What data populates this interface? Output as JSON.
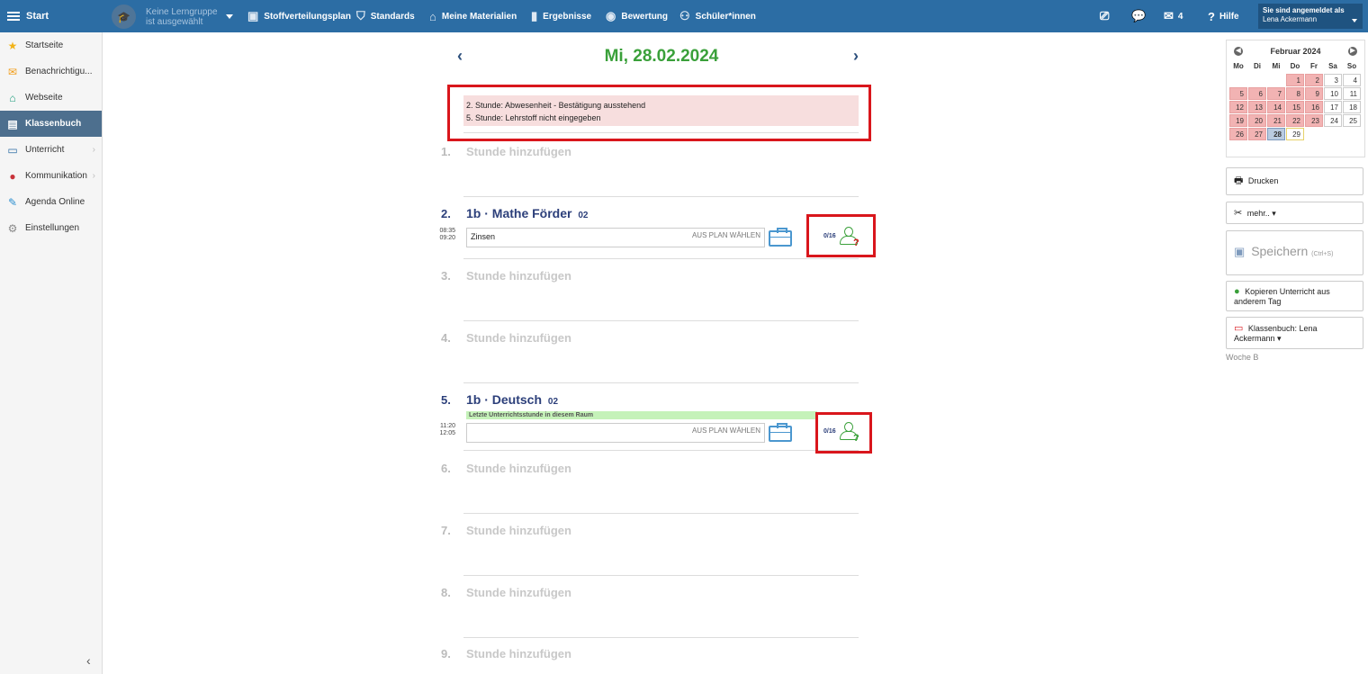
{
  "topbar": {
    "start_label": "Start",
    "group_line1": "Keine Lerngruppe",
    "group_line2": "ist ausgewählt",
    "nav": [
      {
        "label": "Stoffverteilungsplan",
        "icon": "briefcase-icon"
      },
      {
        "label": "Standards",
        "icon": "shield-icon"
      },
      {
        "label": "Meine Materialien",
        "icon": "library-icon"
      },
      {
        "label": "Ergebnisse",
        "icon": "bar-chart-icon"
      },
      {
        "label": "Bewertung",
        "icon": "rating-icon"
      },
      {
        "label": "Schüler*innen",
        "icon": "students-icon"
      }
    ],
    "message_count": "4",
    "help_label": "Hilfe",
    "user_label": "Sie sind angemeldet als",
    "user_name": "Lena Ackermann"
  },
  "sidebar": {
    "items": [
      {
        "label": "Startseite",
        "icon": "star-icon"
      },
      {
        "label": "Benachrichtigu...",
        "icon": "envelope-icon"
      },
      {
        "label": "Webseite",
        "icon": "home-icon"
      },
      {
        "label": "Klassenbuch",
        "icon": "book-icon",
        "active": true
      },
      {
        "label": "Unterricht",
        "icon": "classroom-icon"
      },
      {
        "label": "Kommunikation",
        "icon": "chat-icon"
      },
      {
        "label": "Agenda Online",
        "icon": "pen-icon"
      },
      {
        "label": "Einstellungen",
        "icon": "gear-icon"
      }
    ]
  },
  "main": {
    "date_title": "Mi, 28.02.2024",
    "warnings": [
      "2. Stunde: Abwesenheit - Bestätigung ausstehend",
      "5. Stunde: Lehrstoff nicht eingegeben"
    ],
    "add_label": "Stunde hinzufügen",
    "slots": {
      "s1": "1.",
      "s3": "3.",
      "s4": "4.",
      "s6": "6.",
      "s7": "7.",
      "s8": "8.",
      "s9": "9."
    },
    "lesson2": {
      "num": "2.",
      "title": "1b · Mathe Förder",
      "room": "02",
      "time_start": "08:35",
      "time_end": "09:20",
      "topic": "Zinsen",
      "plan_label": "AUS PLAN WÄHLEN",
      "attendance": "0/16",
      "status_color": "#d9161c"
    },
    "lesson5": {
      "num": "5.",
      "title": "1b · Deutsch",
      "room": "02",
      "time_start": "11:20",
      "time_end": "12:05",
      "notice": "Letzte Unterrichtsstunde in diesem Raum",
      "topic": "",
      "plan_label": "AUS PLAN WÄHLEN",
      "attendance": "0/16",
      "status_color": "#3aa03a"
    }
  },
  "calendar": {
    "month_label": "Februar 2024",
    "weekdays": [
      "Mo",
      "Di",
      "Mi",
      "Do",
      "Fr",
      "Sa",
      "So"
    ]
  },
  "right": {
    "print_label": "Drucken",
    "more_label": "mehr.. ▾",
    "save_label": "Speichern",
    "save_shortcut": "(Ctrl+S)",
    "copy_label": "Kopieren Unterricht aus anderem Tag",
    "classbook_label": "Klassenbuch: Lena Ackermann ▾",
    "week_label": "Woche B"
  }
}
